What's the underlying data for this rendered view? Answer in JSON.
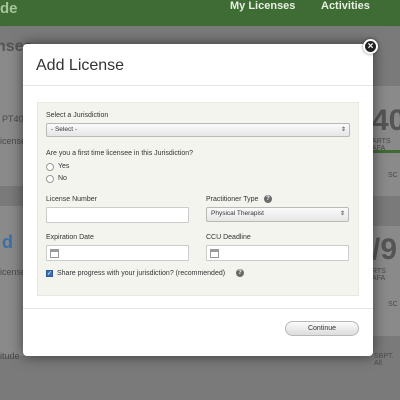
{
  "background": {
    "logo": "de",
    "nav": [
      "My Licenses",
      "Activities"
    ],
    "left_fragments": [
      "nses",
      "PT40",
      "icense",
      "d",
      "icense",
      "itude"
    ],
    "right_fragments": [
      "40",
      "ARTS AFA",
      "SC",
      "/9",
      "RTS AFA",
      "SC",
      "SBPT. All"
    ]
  },
  "modal": {
    "title": "Add License",
    "close_glyph": "×",
    "jurisdiction": {
      "label": "Select a Jurisdiction",
      "value": "- Select -"
    },
    "first_time": {
      "question": "Are you a first time licensee in this Jurisdiction?",
      "options": [
        "Yes",
        "No"
      ]
    },
    "license_number": {
      "label": "License Number",
      "value": ""
    },
    "practitioner_type": {
      "label": "Practitioner Type",
      "value": "Physical Therapist",
      "help_icon": "?"
    },
    "expiration_date": {
      "label": "Expiration Date"
    },
    "ccu_deadline": {
      "label": "CCU Deadline"
    },
    "share": {
      "label": "Share progress with your jurisdiction? (recommended)",
      "checked": true,
      "check_glyph": "✓",
      "help_icon": "?"
    },
    "continue_label": "Continue"
  }
}
